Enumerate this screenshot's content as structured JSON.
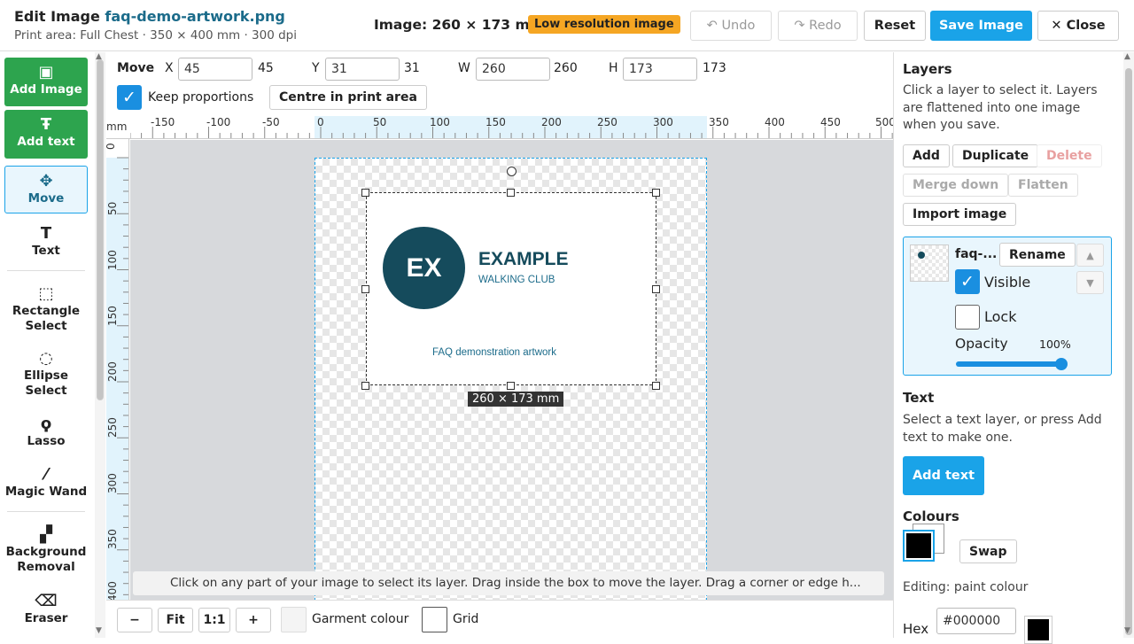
{
  "header": {
    "title_prefix": "Edit Image",
    "filename": "faq-demo-artwork.png",
    "subtitle": "Print area: Full Chest · 350 × 400 mm · 300 dpi",
    "image_size": "Image: 260 × 173 mm",
    "low_res_badge": "Low resolution image",
    "undo": "Undo",
    "redo": "Redo",
    "reset": "Reset",
    "save": "Save Image",
    "close": "Close"
  },
  "tools": {
    "add_image": "Add Image",
    "add_text": "Add text",
    "move": "Move",
    "text": "Text",
    "rect_select_1": "Rectangle",
    "rect_select_2": "Select",
    "ellipse_select_1": "Ellipse",
    "ellipse_select_2": "Select",
    "lasso": "Lasso",
    "magic_wand": "Magic Wand",
    "bg_removal_1": "Background",
    "bg_removal_2": "Removal",
    "eraser": "Eraser"
  },
  "options": {
    "mode": "Move",
    "x_label": "X",
    "x_value": "45",
    "x_display": "45",
    "y_label": "Y",
    "y_value": "31",
    "y_display": "31",
    "w_label": "W",
    "w_value": "260",
    "w_display": "260",
    "h_label": "H",
    "h_value": "173",
    "h_display": "173",
    "keep_proportions": "Keep proportions",
    "centre": "Centre in print area"
  },
  "ruler": {
    "unit": "mm",
    "top_ticks": [
      "-150",
      "-100",
      "-50",
      "0",
      "50",
      "100",
      "150",
      "200",
      "250",
      "300",
      "350",
      "400",
      "450",
      "500"
    ],
    "left_ticks": [
      "0",
      "50",
      "100",
      "150",
      "200",
      "250",
      "300",
      "350",
      "400"
    ]
  },
  "artwork": {
    "logo_initials": "EX",
    "logo_title": "EXAMPLE",
    "logo_subtitle": "WALKING CLUB",
    "caption": "FAQ demonstration artwork"
  },
  "canvas": {
    "dimension_tag": "260 × 173 mm",
    "hint": "Click on any part of your image to select its layer. Drag inside the box to move the layer. Drag a corner or edge h..."
  },
  "bottom": {
    "zoom_out": "−",
    "fit": "Fit",
    "one_to_one": "1:1",
    "zoom_in": "+",
    "garment_colour": "Garment colour",
    "grid": "Grid"
  },
  "layers": {
    "heading": "Layers",
    "description": "Click a layer to select it. Layers are flattened into one image when you save.",
    "add": "Add",
    "duplicate": "Duplicate",
    "delete": "Delete",
    "merge_down": "Merge down",
    "flatten": "Flatten",
    "import": "Import image",
    "item": {
      "name": "faq-...",
      "rename": "Rename",
      "visible_label": "Visible",
      "lock_label": "Lock",
      "opacity_label": "Opacity",
      "opacity_value": "100%",
      "opacity_level": 1.0
    }
  },
  "text_panel": {
    "heading": "Text",
    "description": "Select a text layer, or press Add text to make one.",
    "add_button": "Add text"
  },
  "colours": {
    "heading": "Colours",
    "swap": "Swap",
    "editing": "Editing: paint colour",
    "hex_label": "Hex",
    "hex_value": "#000000",
    "primary": "#000000",
    "secondary": "#ffffff",
    "accent": "#1aa3e8",
    "brand_dark": "#154b5c"
  }
}
